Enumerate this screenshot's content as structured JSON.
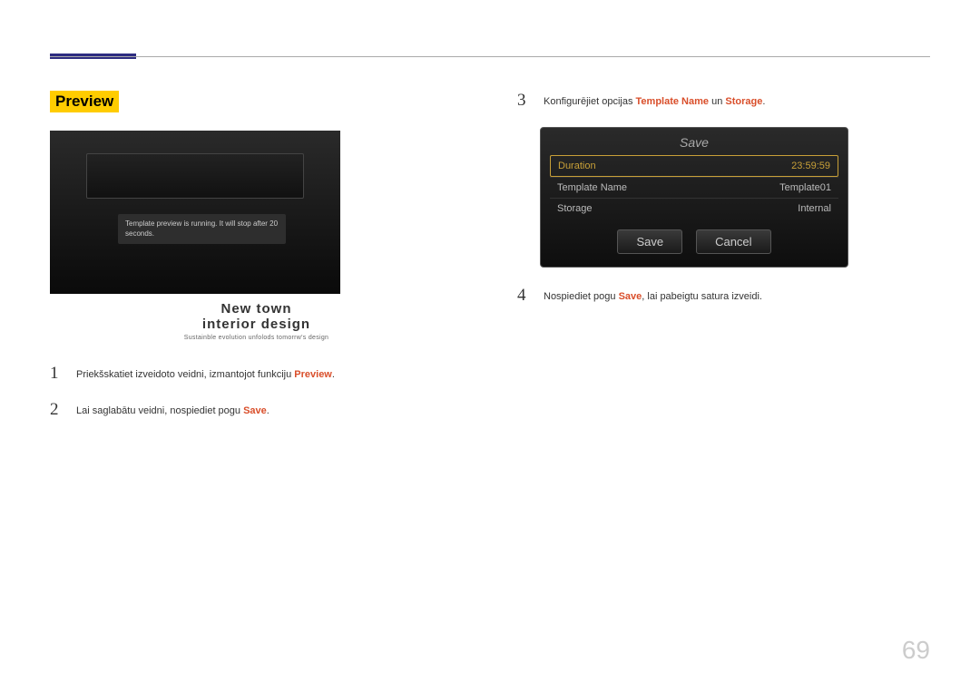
{
  "heading": "Preview",
  "preview": {
    "message": "Template preview is running. It will stop after 20 seconds.",
    "title": "New town",
    "subtitle": "interior design",
    "tagline": "Sustainble evolution unfolods tomorrw's design"
  },
  "steps_left": [
    {
      "num": "1",
      "pre": "Priekšskatiet izveidoto veidni, izmantojot funkciju ",
      "hl": "Preview",
      "post": "."
    },
    {
      "num": "2",
      "pre": "Lai saglabātu veidni, nospiediet pogu ",
      "hl": "Save",
      "post": "."
    }
  ],
  "steps_right": {
    "s3": {
      "num": "3",
      "pre": "Konfigurējiet opcijas ",
      "hl1": "Template Name",
      "mid": " un ",
      "hl2": "Storage",
      "post": "."
    },
    "s4": {
      "num": "4",
      "pre": "Nospiediet pogu ",
      "hl": "Save",
      "post": ", lai pabeigtu satura izveidi."
    }
  },
  "save_panel": {
    "title": "Save",
    "rows": [
      {
        "label": "Duration",
        "value": "23:59:59",
        "selected": true
      },
      {
        "label": "Template Name",
        "value": "Template01",
        "selected": false
      },
      {
        "label": "Storage",
        "value": "Internal",
        "selected": false
      }
    ],
    "btn_save": "Save",
    "btn_cancel": "Cancel"
  },
  "page_number": "69"
}
